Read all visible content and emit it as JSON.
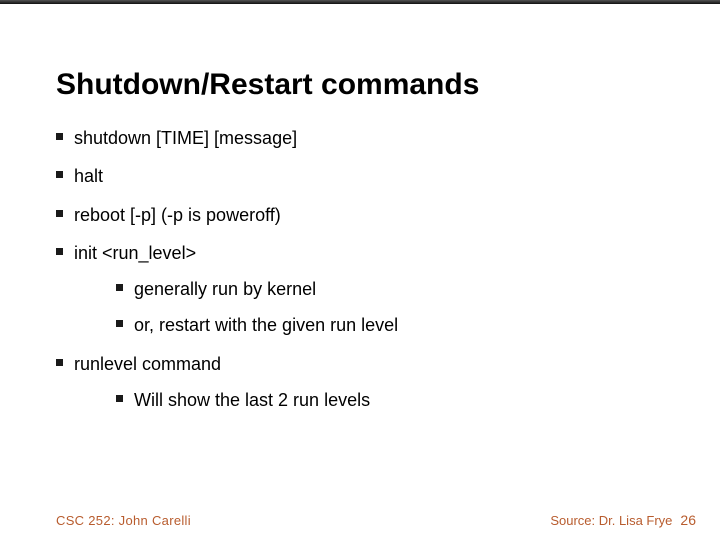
{
  "title": "Shutdown/Restart commands",
  "bullets": {
    "b0": "shutdown  [TIME]  [message]",
    "b1": "halt",
    "b2": "reboot  [-p]  (-p is poweroff)",
    "b3": "init   <run_level>",
    "b3sub": {
      "s0": "generally run by kernel",
      "s1": "or, restart with the given run level"
    },
    "b4": "runlevel command",
    "b4sub": {
      "s0": "Will show the last 2 run levels"
    }
  },
  "footer": {
    "left": "CSC 252: John Carelli",
    "right": "Source: Dr. Lisa Frye",
    "page": "26"
  }
}
